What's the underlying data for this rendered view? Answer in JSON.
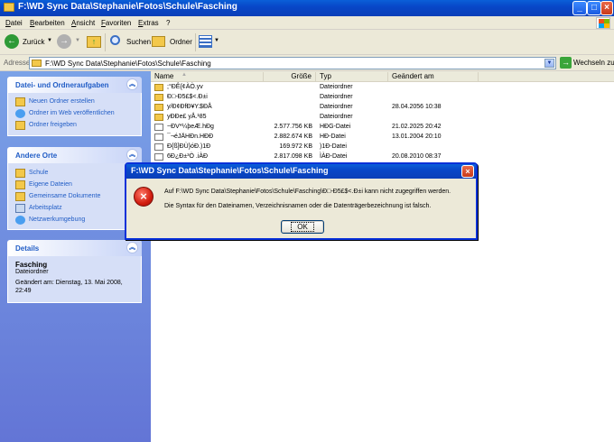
{
  "window": {
    "title": "F:\\WD Sync Data\\Stephanie\\Fotos\\Schule\\Fasching"
  },
  "menu": [
    "Datei",
    "Bearbeiten",
    "Ansicht",
    "Favoriten",
    "Extras",
    "?"
  ],
  "toolbar": {
    "back_label": "Zurück",
    "search_label": "Suchen",
    "folders_label": "Ordner"
  },
  "address": {
    "label": "Adresse",
    "value": "F:\\WD Sync Data\\Stephanie\\Fotos\\Schule\\Fasching",
    "go_label": "Wechseln zu"
  },
  "sidebar": {
    "file_tasks": {
      "title": "Datei- und Ordneraufgaben",
      "items": [
        "Neuen Ordner erstellen",
        "Ordner im Web veröffentlichen",
        "Ordner freigeben"
      ]
    },
    "other_places": {
      "title": "Andere Orte",
      "items": [
        "Schule",
        "Eigene Dateien",
        "Gemeinsame Dokumente",
        "Arbeitsplatz",
        "Netzwerkumgebung"
      ]
    },
    "details": {
      "title": "Details",
      "name": "Fasching",
      "type": "Dateiordner",
      "modified": "Geändert am: Dienstag, 13. Mai 2008, 22:49"
    }
  },
  "filelist": {
    "columns": [
      "Name",
      "Größe",
      "Typ",
      "Geändert am"
    ],
    "rows": [
      {
        "name": ";°ÐÊ{¢ÀÒ.yv",
        "size": "",
        "type": "Dateiordner",
        "modified": "",
        "kind": "folder"
      },
      {
        "name": "Ð□-Ð5£$<.Ð±i",
        "size": "",
        "type": "Dateiordner",
        "modified": "",
        "kind": "folder"
      },
      {
        "name": "y/Ð¢ÐfÐ¥Y.$ÐÅ",
        "size": "",
        "type": "Dateiordner",
        "modified": "28.04.2056 10:38",
        "kind": "folder"
      },
      {
        "name": "yÐÐe£ yÅ.¹85",
        "size": "",
        "type": "Dateiordner",
        "modified": "",
        "kind": "folder"
      },
      {
        "name": "~ÐV*¼þeÆ.hÐg",
        "size": "2.577.756 KB",
        "type": "HÐG-Datei",
        "modified": "21.02.2025 20:42",
        "kind": "file"
      },
      {
        "name": "¯¬éJÄHÐn.HÐÐ",
        "size": "2.882.674 KB",
        "type": "HÐ-Datei",
        "modified": "13.01.2004 20:10",
        "kind": "file"
      },
      {
        "name": "Ð{ß]ÐÙ}óÐ.)1Ð",
        "size": "169.972 KB",
        "type": ")1Ð-Datei",
        "modified": "",
        "kind": "file"
      },
      {
        "name": "6Ð¿Ð±³Ò .iÀÐ",
        "size": "2.817.098 KB",
        "type": "ÌÀÐ-Datei",
        "modified": "20.08.2010 08:37",
        "kind": "file"
      }
    ]
  },
  "dialog": {
    "title": "F:\\WD Sync Data\\Stephanie\\Fotos\\Schule\\Fasching",
    "message1": "Auf F:\\WD Sync Data\\Stephanie\\Fotos\\Schule\\Fasching\\Ð□-Ð5£$<.Ð±i kann nicht zugegriffen werden.",
    "message2": "Die Syntax für den Dateinamen, Verzeichnisnamen oder die Datenträgerbezeichnung ist falsch.",
    "ok_label": "OK"
  },
  "colors": {
    "titlebar": "#0a52d0",
    "taskpane": "#6f8ae0",
    "link": "#215dc6",
    "error": "#d21d0f"
  }
}
